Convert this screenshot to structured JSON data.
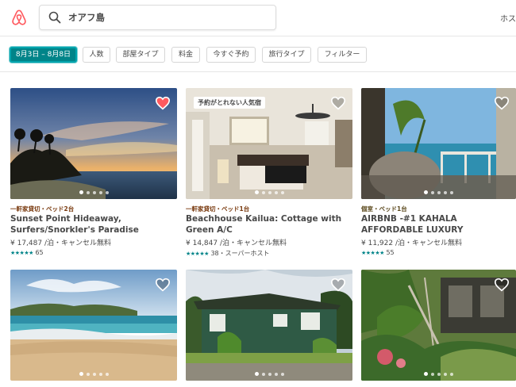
{
  "header": {
    "search_value": "オアフ島",
    "host_link": "ホス"
  },
  "filters": [
    {
      "label": "8月3日 – 8月8日",
      "active": true
    },
    {
      "label": "人数"
    },
    {
      "label": "部屋タイプ"
    },
    {
      "label": "料金"
    },
    {
      "label": "今すぐ予約"
    },
    {
      "label": "旅行タイプ"
    },
    {
      "label": "フィルター"
    }
  ],
  "listings": [
    {
      "type": "一軒家貸切・ベッド2台",
      "type_color": "#7a3b10",
      "title": "Sunset Point Hideaway, Surfers/Snorkler's Paradise",
      "price": "¥ 17,487 /泊・キャンセル無料",
      "stars": "★★★★★",
      "reviews": "65",
      "favorited": true
    },
    {
      "badge": "予約がとれない人気宿",
      "type": "一軒家貸切・ベッド1台",
      "type_color": "#7a3b10",
      "title": "Beachhouse Kailua: Cottage with Green A/C",
      "price": "¥ 14,847 /泊・キャンセル無料",
      "stars": "★★★★★",
      "reviews": "38",
      "superhost": "・スーパーホスト",
      "favorited": false
    },
    {
      "type": "個室・ベッド1台",
      "type_color": "#5c4a1e",
      "title": "AIRBNB -#1 KAHALA AFFORDABLE LUXURY",
      "price": "¥ 11,922 /泊・キャンセル無料",
      "stars": "★★★★★",
      "reviews": "55",
      "favorited": false
    },
    {
      "favorited": false
    },
    {
      "favorited": false
    },
    {
      "favorited": false
    }
  ],
  "icons": {
    "logo": "airbnb-logo-icon",
    "search": "search-icon",
    "heart": "heart-icon"
  },
  "colors": {
    "brand": "#ff5a5f",
    "active_filter": "#008489",
    "star": "#008489"
  }
}
